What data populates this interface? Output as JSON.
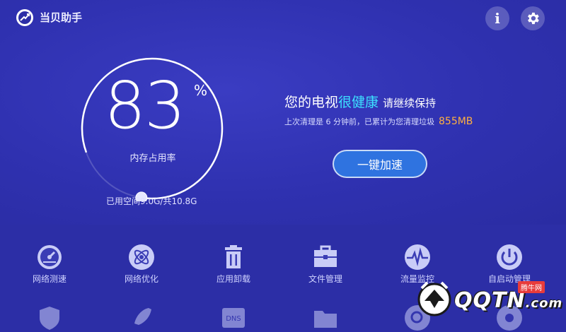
{
  "app": {
    "title": "当贝助手"
  },
  "header": {
    "info_glyph": "i"
  },
  "memory": {
    "percent": "83",
    "percent_sign": "%",
    "label": "内存占用率",
    "used_prefix": "已用空间",
    "used": "9.0G",
    "separator": "/共",
    "total": "10.8G"
  },
  "health": {
    "prefix": "您的电视",
    "highlight": "很健康",
    "suffix": "请继续保持"
  },
  "last_clean": {
    "text": "上次清理是 6 分钟前，已累计为您清理垃圾",
    "amount": "855MB"
  },
  "speed_button": {
    "label": "一键加速"
  },
  "tools": [
    {
      "label": "网络测速",
      "icon": "speedometer-icon"
    },
    {
      "label": "网络优化",
      "icon": "atom-icon"
    },
    {
      "label": "应用卸载",
      "icon": "trash-icon"
    },
    {
      "label": "文件管理",
      "icon": "briefcase-icon"
    },
    {
      "label": "流量监控",
      "icon": "pulse-icon"
    },
    {
      "label": "自启动管理",
      "icon": "power-icon"
    }
  ],
  "tools_row2": [
    {
      "icon": "shield-icon"
    },
    {
      "icon": "rocket-icon"
    },
    {
      "icon": "dns-icon",
      "text": "DNS"
    },
    {
      "icon": "folder-icon"
    },
    {
      "icon": "search-device-icon"
    },
    {
      "icon": "gear-icon"
    }
  ],
  "watermark": {
    "text": "QQTN",
    "dot": ".com",
    "badge": "腾牛网"
  },
  "colors": {
    "background": "#2c2ea6",
    "highlight": "#3ce0ff",
    "amount": "#ffb040",
    "button": "#2f73e0"
  }
}
